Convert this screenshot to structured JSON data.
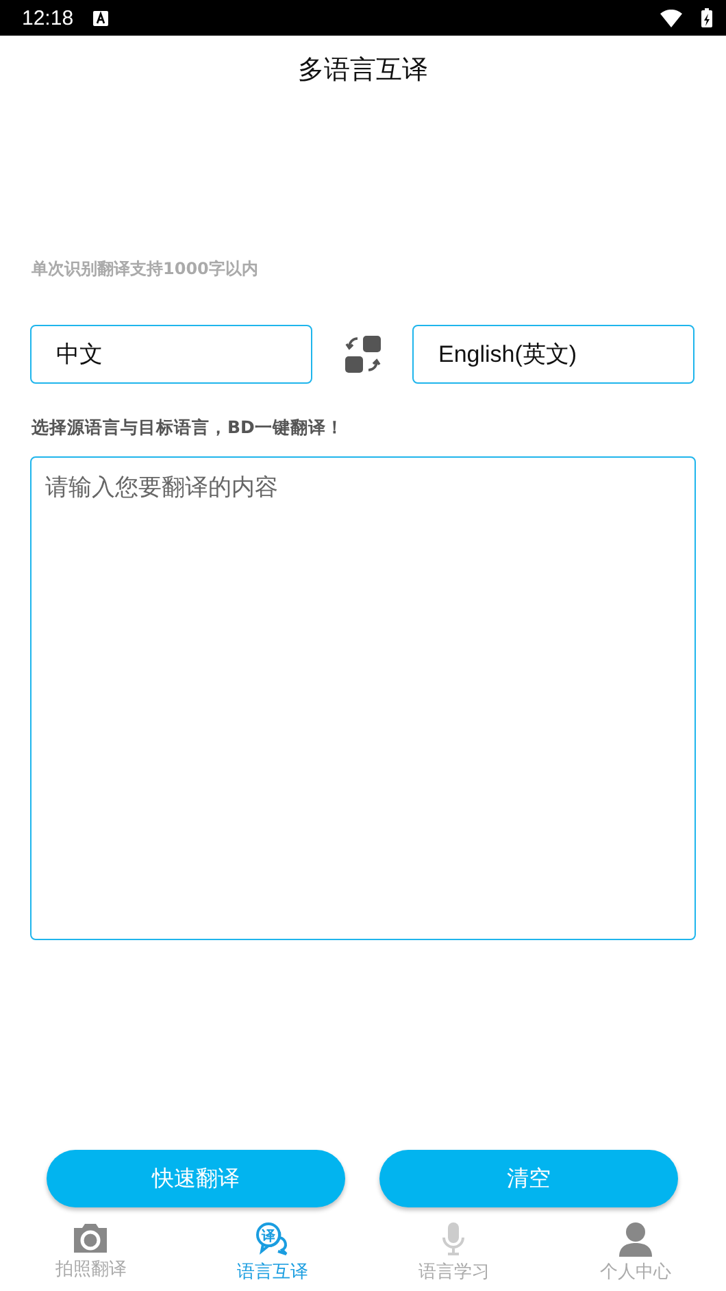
{
  "status_bar": {
    "time": "12:18"
  },
  "title": "多语言互译",
  "hint": "单次识别翻译支持1000字以内",
  "source_language": "中文",
  "target_language": "English(英文)",
  "instruction": "选择源语言与目标语言，BD一键翻译！",
  "input": {
    "placeholder": "请输入您要翻译的内容"
  },
  "buttons": [
    "快速翻译",
    "清空"
  ],
  "nav": [
    {
      "label": "拍照翻译",
      "kind": "camera",
      "selected": false
    },
    {
      "label": "语言互译",
      "kind": "chat",
      "icon_text": "译",
      "selected": true
    },
    {
      "label": "语言学习",
      "kind": "mic",
      "selected": false
    },
    {
      "label": "个人中心",
      "kind": "person",
      "selected": false
    }
  ]
}
